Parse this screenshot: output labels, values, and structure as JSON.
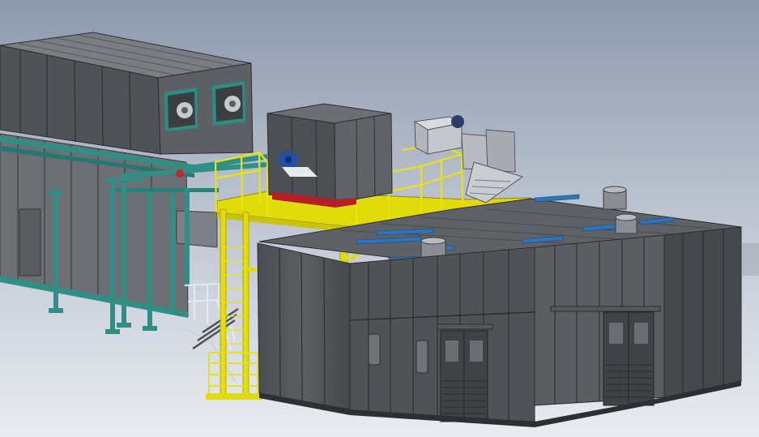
{
  "colors": {
    "background_top": "#8d99ad",
    "background_bottom": "#e9ecf1",
    "booth_dark": "#3e4145",
    "booth_mid": "#55585c",
    "booth_light": "#6e7276",
    "roof": "#5d6165",
    "oven_grey": "#6a6d71",
    "platform_yellow": "#e8e10a",
    "rail_teal": "#2f8f86",
    "filter_blue": "#2f74b8",
    "duct_silver": "#b8bcc2"
  }
}
